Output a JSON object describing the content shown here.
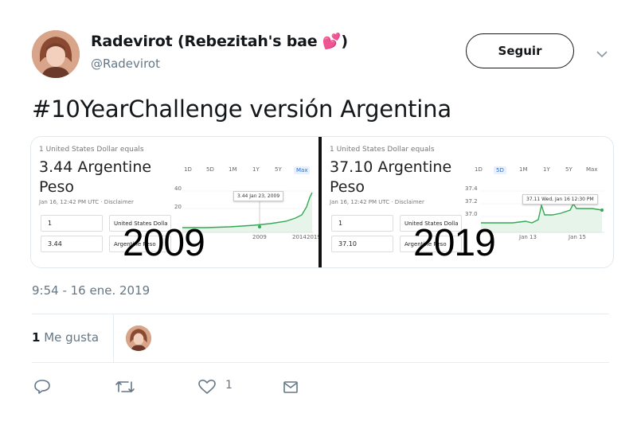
{
  "author": {
    "name": "Radevirot (Rebezitah's bae",
    "name_close": ")",
    "heart": "💕",
    "handle": "@Radevirot"
  },
  "follow_label": "Seguir",
  "tweet_text": "#10YearChallenge versión Argentina",
  "media": {
    "left": {
      "header": "1 United States Dollar equals",
      "value_line1": "3.44 Argentine",
      "value_line2": "Peso",
      "date": "Jan 16, 12:42 PM UTC · Disclaimer",
      "input_top": "1",
      "select_top": "United States Dolla",
      "input_bottom": "3.44",
      "select_bottom": "Argentine Peso",
      "ranges": [
        "1D",
        "5D",
        "1M",
        "1Y",
        "5Y",
        "Max"
      ],
      "selected_range": "Max",
      "tooltip": "3.44  Jan 23, 2009",
      "y_ticks": [
        "40",
        "20"
      ],
      "x_ticks": [
        "2009",
        "2014",
        "2019"
      ],
      "year_overlay": "2009"
    },
    "right": {
      "header": "1 United States Dollar equals",
      "value_line1": "37.10 Argentine",
      "value_line2": "Peso",
      "date": "Jan 16, 12:42 PM UTC · Disclaimer",
      "input_top": "1",
      "select_top": "United States Dolla",
      "input_bottom": "37.10",
      "select_bottom": "Argentine Peso",
      "ranges": [
        "1D",
        "5D",
        "1M",
        "1Y",
        "5Y",
        "Max"
      ],
      "selected_range": "5D",
      "tooltip": "37.11  Wed, Jan 16 12:30 PM",
      "y_ticks": [
        "37.4",
        "37.2",
        "37.0"
      ],
      "x_ticks": [
        "Jan 13",
        "Jan 15"
      ],
      "year_overlay": "2019"
    }
  },
  "timestamp": "9:54 - 16 ene. 2019",
  "likes": {
    "count": "1",
    "label": "Me gusta"
  },
  "actions": {
    "like_count": "1"
  },
  "colors": {
    "chart_line": "#34a853",
    "chart_fill": "#e6f4ea",
    "heart": "#d6224a",
    "muted": "#657786"
  },
  "icons": [
    "reply-icon",
    "retweet-icon",
    "heart-icon",
    "message-icon",
    "chevron-down-icon"
  ]
}
